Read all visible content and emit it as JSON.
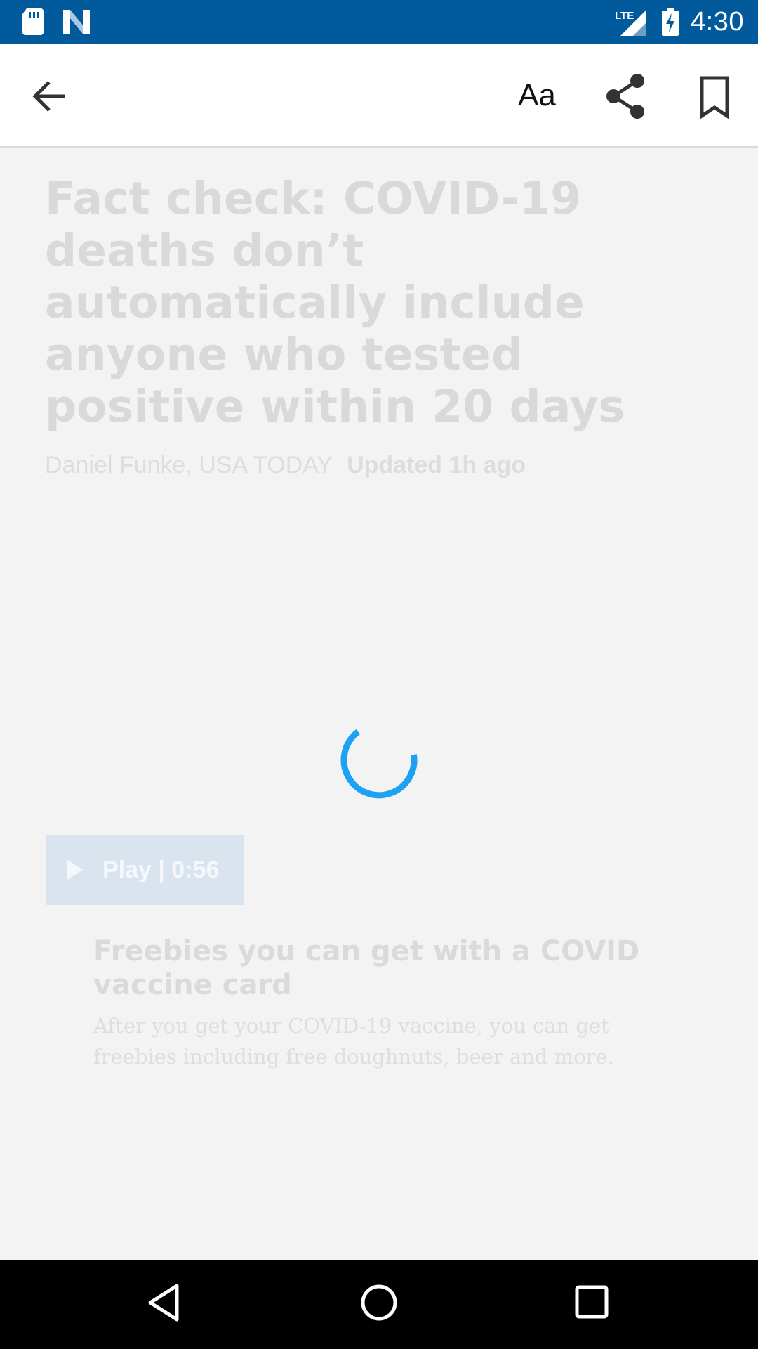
{
  "status_bar": {
    "time": "4:30",
    "network": "LTE",
    "background_color": "#005a9c",
    "icons": [
      "sd-card-icon",
      "news-app-icon",
      "lte-signal-icon",
      "battery-charging-icon"
    ]
  },
  "toolbar": {
    "text_size_label": "Aa",
    "icons": [
      "back-arrow-icon",
      "share-icon",
      "bookmark-icon"
    ]
  },
  "article": {
    "headline": "Fact check: COVID-19 deaths don’t automatically include anyone who tested positive within 20 days",
    "author": "Daniel Funke, USA TODAY",
    "updated": "Updated 1h ago"
  },
  "loading": {
    "spinner_color": "#1da1f2"
  },
  "video": {
    "play_label": "Play | 0:56",
    "title": "Freebies you can get with a COVID vaccine card",
    "description": "After you get your COVID-19 vaccine, you can get freebies including free doughnuts, beer and more."
  },
  "nav_bar": {
    "icons": [
      "nav-back-icon",
      "nav-home-icon",
      "nav-recents-icon"
    ]
  }
}
